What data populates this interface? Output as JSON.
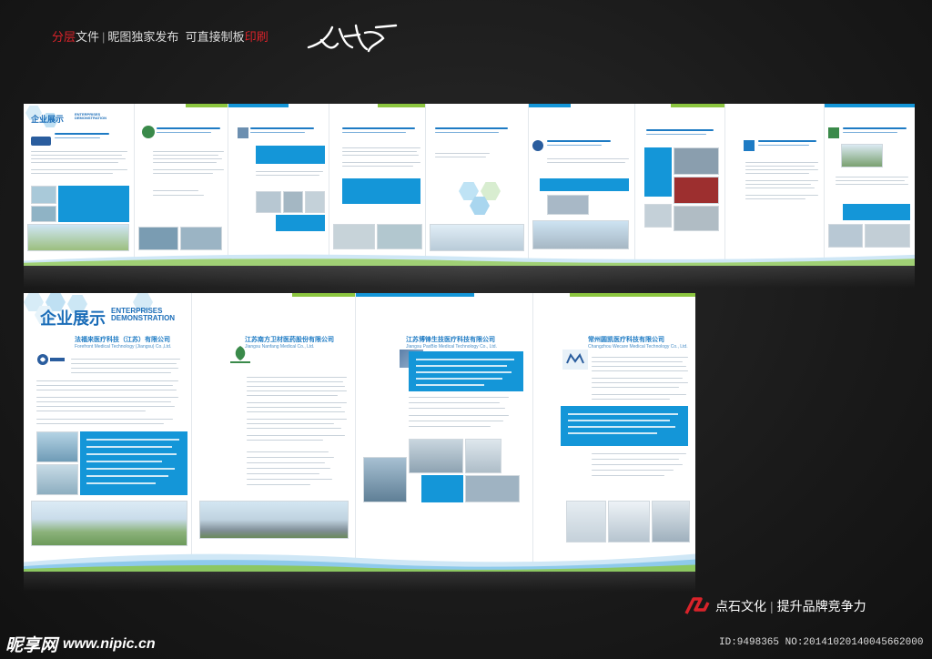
{
  "banner": {
    "part1": "分层",
    "part2": "文件",
    "separator": "|",
    "part3": "昵图独家发布",
    "part4": "可直接制板",
    "part5": "印刷"
  },
  "colors": {
    "accent_blue": "#1496d8",
    "accent_green": "#8cc63f",
    "brand_red": "#d9232a"
  },
  "top_strip": {
    "header_cn": "企业展示",
    "header_en": [
      "ENTERPRISES",
      "DEMONSTRATION"
    ]
  },
  "bottom_strip": {
    "header_cn": "企业展示",
    "header_en": [
      "ENTERPRISES",
      "DEMONSTRATION"
    ],
    "panels": [
      {
        "company_cn": "法福来医疗科技（江苏）有限公司",
        "company_en": "Forefront Medical Technology (Jiangsu) Co.,Ltd."
      },
      {
        "company_cn": "江苏南方卫材医药股份有限公司",
        "company_en": "Jiangsu Nanfang Medical Co., Ltd."
      },
      {
        "company_cn": "江苏博锋生技医疗科技有限公司",
        "company_en": "Jiangsu PaxBio Medical Technology Co., Ltd."
      },
      {
        "company_cn": "常州圆凯医疗科技有限公司",
        "company_en": "Changzhou Wecare Medical Technology Co., Ltd."
      }
    ]
  },
  "footer": {
    "brand_name": "点石文化",
    "brand_sep": "|",
    "brand_slogan": "提升品牌竞争力",
    "site_name": "昵享网",
    "site_url": "www.nipic.cn",
    "id_text": "ID:9498365 NO:20141020140045662000"
  }
}
